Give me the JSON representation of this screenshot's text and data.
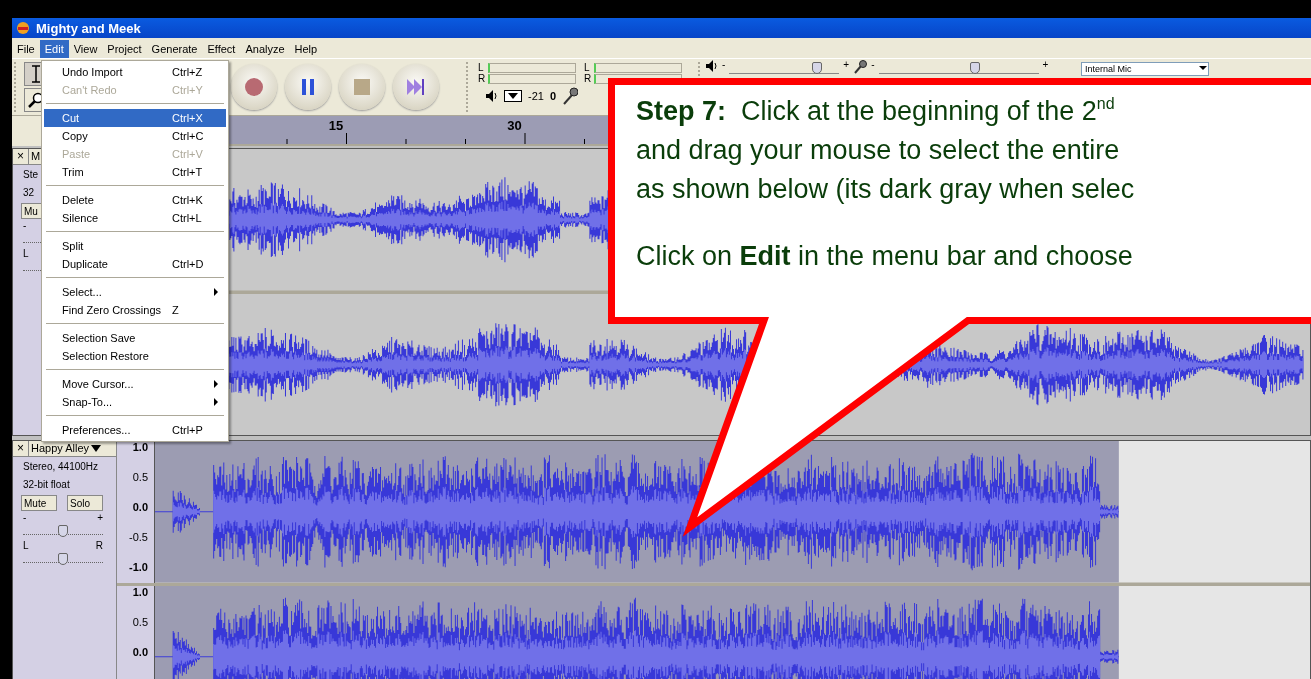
{
  "window": {
    "title": "Mighty and Meek"
  },
  "menu_bar": [
    {
      "label": "File",
      "selected": false
    },
    {
      "label": "Edit",
      "selected": true
    },
    {
      "label": "View",
      "selected": false
    },
    {
      "label": "Project",
      "selected": false
    },
    {
      "label": "Generate",
      "selected": false
    },
    {
      "label": "Effect",
      "selected": false
    },
    {
      "label": "Analyze",
      "selected": false
    },
    {
      "label": "Help",
      "selected": false
    }
  ],
  "edit_menu": {
    "groups": [
      {
        "items": [
          {
            "label": "Undo Import",
            "shortcut": "Ctrl+Z",
            "kind": "command",
            "disabled": false,
            "selected": false
          },
          {
            "label": "Can't Redo",
            "shortcut": "Ctrl+Y",
            "kind": "command",
            "disabled": true,
            "selected": false
          }
        ]
      },
      {
        "items": [
          {
            "label": "Cut",
            "shortcut": "Ctrl+X",
            "kind": "command",
            "disabled": false,
            "selected": true
          },
          {
            "label": "Copy",
            "shortcut": "Ctrl+C",
            "kind": "command",
            "disabled": false,
            "selected": false
          },
          {
            "label": "Paste",
            "shortcut": "Ctrl+V",
            "kind": "command",
            "disabled": true,
            "selected": false
          },
          {
            "label": "Trim",
            "shortcut": "Ctrl+T",
            "kind": "command",
            "disabled": false,
            "selected": false
          }
        ]
      },
      {
        "items": [
          {
            "label": "Delete",
            "shortcut": "Ctrl+K",
            "kind": "command",
            "disabled": false,
            "selected": false
          },
          {
            "label": "Silence",
            "shortcut": "Ctrl+L",
            "kind": "command",
            "disabled": false,
            "selected": false
          }
        ]
      },
      {
        "items": [
          {
            "label": "Split",
            "kind": "command",
            "disabled": false,
            "selected": false
          },
          {
            "label": "Duplicate",
            "shortcut": "Ctrl+D",
            "kind": "command",
            "disabled": false,
            "selected": false
          }
        ]
      },
      {
        "items": [
          {
            "label": "Select...",
            "kind": "submenu",
            "disabled": false,
            "selected": false
          },
          {
            "label": "Find Zero Crossings",
            "shortcut": "Z",
            "kind": "command",
            "disabled": false,
            "selected": false
          }
        ]
      },
      {
        "items": [
          {
            "label": "Selection Save",
            "kind": "command",
            "disabled": false,
            "selected": false
          },
          {
            "label": "Selection Restore",
            "kind": "command",
            "disabled": false,
            "selected": false
          }
        ]
      },
      {
        "items": [
          {
            "label": "Move Cursor...",
            "kind": "submenu",
            "disabled": false,
            "selected": false
          },
          {
            "label": "Snap-To...",
            "kind": "submenu",
            "disabled": false,
            "selected": false
          }
        ]
      },
      {
        "items": [
          {
            "label": "Preferences...",
            "shortcut": "Ctrl+P",
            "kind": "command",
            "disabled": false,
            "selected": false
          }
        ]
      }
    ]
  },
  "toolbar": {
    "meters": [
      {
        "channels": [
          "L",
          "R"
        ]
      },
      {
        "channels": [
          "L",
          "R"
        ]
      }
    ],
    "meter_readings": [
      "-21",
      "0"
    ],
    "mixer": [
      {
        "kind": "output",
        "min": "-",
        "max": "+",
        "level": 0.8
      },
      {
        "kind": "input",
        "min": "-",
        "max": "+",
        "level": 0.6
      }
    ],
    "input_source": "Internal Mic"
  },
  "ruler": {
    "labels": [
      "15",
      "30"
    ]
  },
  "tracks": [
    {
      "close": "×",
      "name": "M",
      "selected": false,
      "info": [
        "Ste",
        "32"
      ],
      "mute": "Mu",
      "gain": {
        "min": "-"
      },
      "pan": {
        "left": "L"
      }
    },
    {
      "close": "×",
      "name": "Happy Alley",
      "selected": true,
      "info": [
        "Stereo, 44100Hz",
        "32-bit float"
      ],
      "mute": "Mute",
      "solo": "Solo",
      "gain": {
        "min": "-",
        "max": "+",
        "level": 0.5
      },
      "pan": {
        "left": "L",
        "right": "R",
        "level": 0.5
      },
      "channels": [
        {
          "scale": [
            "1.0",
            "0.5",
            "0.0",
            "-0.5",
            "-1.0"
          ]
        },
        {
          "scale": [
            "1.0",
            "0.5",
            "0.0"
          ]
        }
      ]
    }
  ],
  "callout": {
    "paragraphs": [
      {
        "lines": [
          "**Step 7:**  Click at the beginning of the 2$^{nd}$",
          "and drag your mouse to select the entire",
          "as shown below (its dark gray when selec"
        ]
      },
      {
        "lines": [
          "Click on **Edit** in the menu bar and choose"
        ]
      }
    ]
  }
}
